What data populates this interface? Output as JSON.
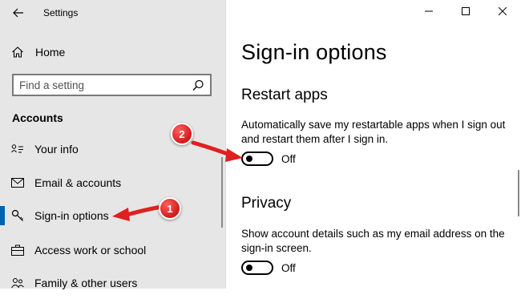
{
  "window": {
    "title": "Settings"
  },
  "sidebar": {
    "home_label": "Home",
    "search_placeholder": "Find a setting",
    "section_label": "Accounts",
    "items": [
      {
        "label": "Your info",
        "icon": "person-card-icon"
      },
      {
        "label": "Email & accounts",
        "icon": "mail-icon"
      },
      {
        "label": "Sign-in options",
        "icon": "key-icon",
        "selected": true
      },
      {
        "label": "Access work or school",
        "icon": "briefcase-icon"
      },
      {
        "label": "Family & other users",
        "icon": "people-icon"
      }
    ]
  },
  "main": {
    "title": "Sign-in options",
    "restart_apps": {
      "heading": "Restart apps",
      "description": "Automatically save my restartable apps when I sign out and restart them after I sign in.",
      "toggle_state": "Off"
    },
    "privacy": {
      "heading": "Privacy",
      "description": "Show account details such as my email address on the sign-in screen.",
      "toggle_state": "Off"
    }
  },
  "annotations": [
    {
      "number": "1"
    },
    {
      "number": "2"
    }
  ],
  "colors": {
    "accent": "#0063b1",
    "sidebar_bg": "#e6e6e6",
    "annotation_red": "#e02020"
  }
}
